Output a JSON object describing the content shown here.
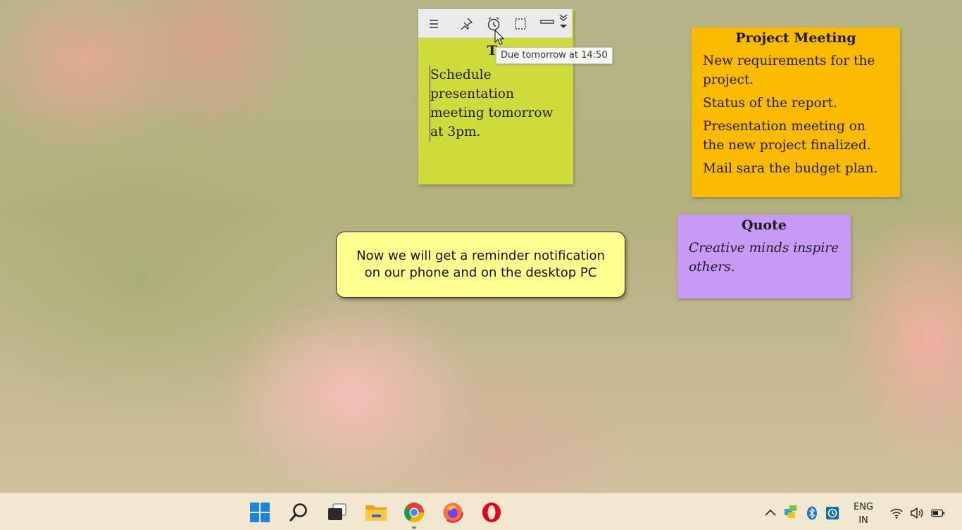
{
  "notes": {
    "todo": {
      "title": "To",
      "lines": [
        "Schedule presentation meeting tomorrow at 3pm."
      ],
      "color": "#cfdb3b",
      "toolbar_icons": [
        "menu-icon",
        "pin-icon",
        "alarm-icon",
        "select-icon",
        "minimize-icon",
        "collapse-icon"
      ]
    },
    "project": {
      "title": "Project Meeting",
      "items": [
        "New requirements for the project.",
        "Status of the report.",
        "Presentation meeting on the new project finalized.",
        "Mail sara the budget plan."
      ],
      "color": "#fdbb00"
    },
    "quote": {
      "title": "Quote",
      "text": "Creative minds inspire others.",
      "color": "#c89af7"
    }
  },
  "tooltip": {
    "text": "Due tomorrow at 14:50"
  },
  "callout": {
    "text": "Now we will get a reminder notification on our phone and on the desktop PC"
  },
  "taskbar": {
    "apps": [
      "windows-start-icon",
      "search-icon",
      "task-view-icon",
      "file-explorer-icon",
      "chrome-icon",
      "firefox-icon",
      "opera-icon"
    ],
    "tray": {
      "lang_line1": "ENG",
      "lang_line2": "IN",
      "icons": [
        "chevron-up-icon",
        "network-monitor-icon",
        "bluetooth-icon",
        "backup-icon",
        "wifi-icon",
        "volume-icon",
        "battery-icon"
      ]
    }
  }
}
